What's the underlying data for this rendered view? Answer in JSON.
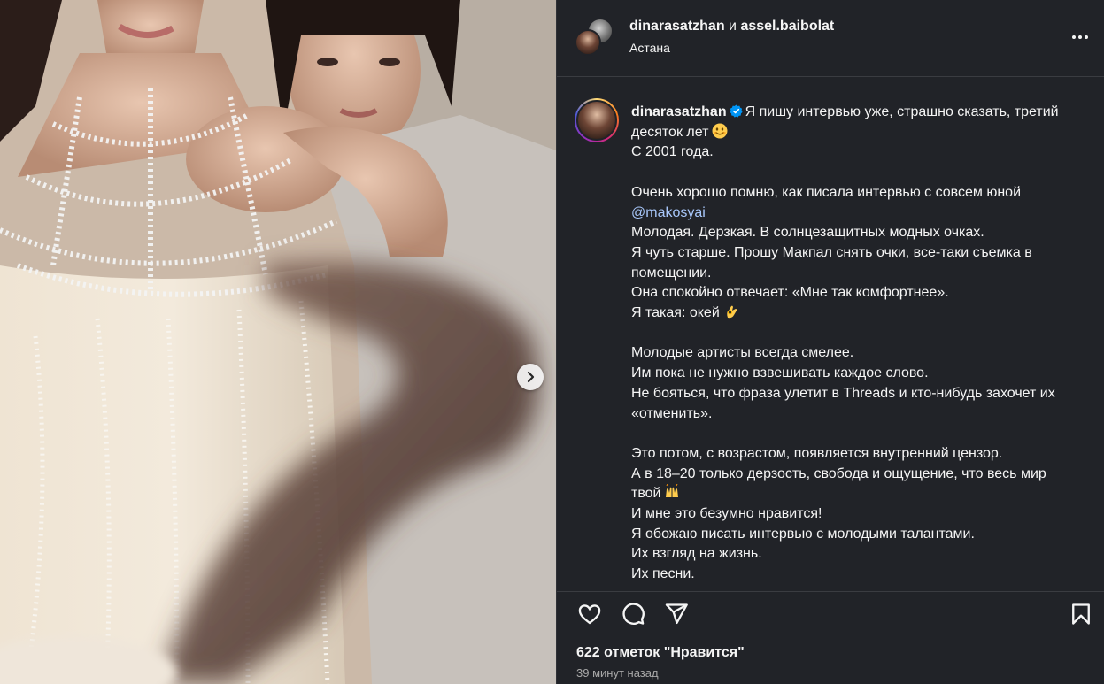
{
  "post": {
    "header": {
      "author1": "dinarasatzhan",
      "conjunction": "и",
      "author2": "assel.baibolat",
      "location": "Астана",
      "more_icon": "more-horizontal-icon"
    },
    "caption": {
      "author": "dinarasatzhan",
      "verified_icon": "verified-badge-icon",
      "lines": [
        {
          "text": "Я пишу интервью уже, страшно сказать, третий",
          "inline_with_author": true
        },
        {
          "text": "десяток лет",
          "emoji": "smiling-face-emoji"
        },
        {
          "text": "С 2001 года."
        },
        {
          "text": ""
        },
        {
          "text": "Очень хорошо помню, как писала интервью с совсем юной"
        },
        {
          "text": "@makosyai",
          "mention": true
        },
        {
          "text": "Молодая. Дерзкая. В солнцезащитных модных очках."
        },
        {
          "text": "Я чуть старше. Прошу Макпал снять очки, все-таки съемка в"
        },
        {
          "text": "помещении."
        },
        {
          "text": "Она спокойно отвечает: «Мне так комфортнее»."
        },
        {
          "text": "Я такая: окей",
          "emoji": "ok-hand-emoji"
        },
        {
          "text": ""
        },
        {
          "text": "Молодые артисты всегда смелее."
        },
        {
          "text": "Им пока не нужно взвешивать каждое слово."
        },
        {
          "text": "Не бояться, что фраза улетит в Threads и кто-нибудь захочет их"
        },
        {
          "text": "«отменить»."
        },
        {
          "text": ""
        },
        {
          "text": "Это потом, с возрастом, появляется внутренний цензор."
        },
        {
          "text": "А в 18–20 только дерзость, свобода и ощущение, что весь мир"
        },
        {
          "text": "твой",
          "emoji": "raising-hands-emoji"
        },
        {
          "text": "И мне это безумно нравится!"
        },
        {
          "text": "Я обожаю писать интервью с молодыми талантами."
        },
        {
          "text": "Их взгляд на жизнь."
        },
        {
          "text": "Их песни."
        }
      ]
    },
    "actions": {
      "like_icon": "heart-icon",
      "comment_icon": "comment-icon",
      "share_icon": "send-icon",
      "save_icon": "bookmark-icon"
    },
    "likes_text": "622 отметок \"Нравится\"",
    "time_text": "39 минут назад",
    "carousel": {
      "next_icon": "chevron-right-icon"
    }
  },
  "colors": {
    "panel_bg": "#212328",
    "text": "#f5f5f5",
    "secondary_text": "#a8a8a8",
    "mention": "#a8c7fa",
    "verified": "#0095f6"
  }
}
